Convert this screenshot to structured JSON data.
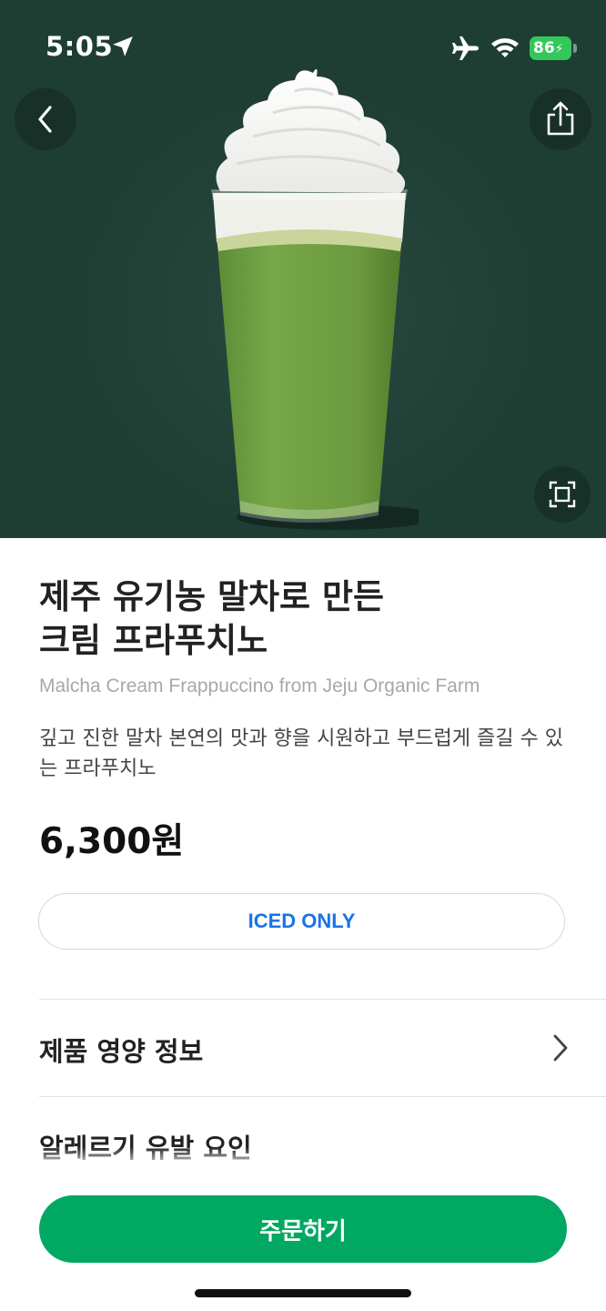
{
  "status_bar": {
    "time": "5:05",
    "battery": "86"
  },
  "product": {
    "name_ko_line1": "제주 유기농 말차로 만든",
    "name_ko_line2": "크림 프라푸치노",
    "name_en": "Malcha Cream Frappuccino from Jeju Organic Farm",
    "description": "깊고 진한 말차 본연의 맛과 향을 시원하고 부드럽게 즐길 수 있는 프라푸치노",
    "price": "6,300원",
    "temperature_option": "ICED ONLY"
  },
  "sections": {
    "nutrition": "제품 영양 정보",
    "allergy": "알레르기 유발 요인"
  },
  "actions": {
    "order": "주문하기"
  },
  "icons": {
    "back": "chevron-left-icon",
    "share": "share-icon",
    "scan": "scan-frame-icon",
    "location": "location-arrow-icon",
    "airplane": "airplane-icon",
    "wifi": "wifi-icon",
    "battery": "battery-icon",
    "chevron": "chevron-right-icon"
  },
  "colors": {
    "hero_bg": "#1e3e34",
    "accent_green": "#00a862",
    "iced_blue": "#1a73e8",
    "battery_green": "#34c759"
  }
}
